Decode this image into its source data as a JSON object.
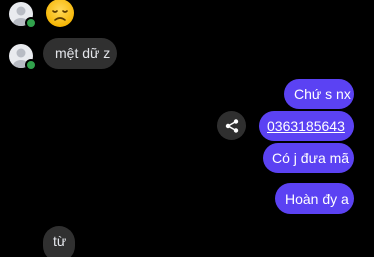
{
  "received": {
    "emoji": "😞",
    "messages": [
      {
        "text": "mệt dữ z"
      },
      {
        "text": "từ"
      }
    ]
  },
  "sent": {
    "messages": [
      {
        "text": "Chứ s nx"
      },
      {
        "text": "0363185643"
      },
      {
        "text": "Có j đưa mã"
      },
      {
        "text": "Hoàn đy a"
      }
    ]
  },
  "icons": {
    "share": "share-icon",
    "avatar": "user-avatar-icon",
    "online": "online-status-dot"
  },
  "colors": {
    "background": "#000000",
    "incoming_bubble": "#303030",
    "outgoing_bubble": "#5b42f3",
    "online": "#31a24c"
  }
}
